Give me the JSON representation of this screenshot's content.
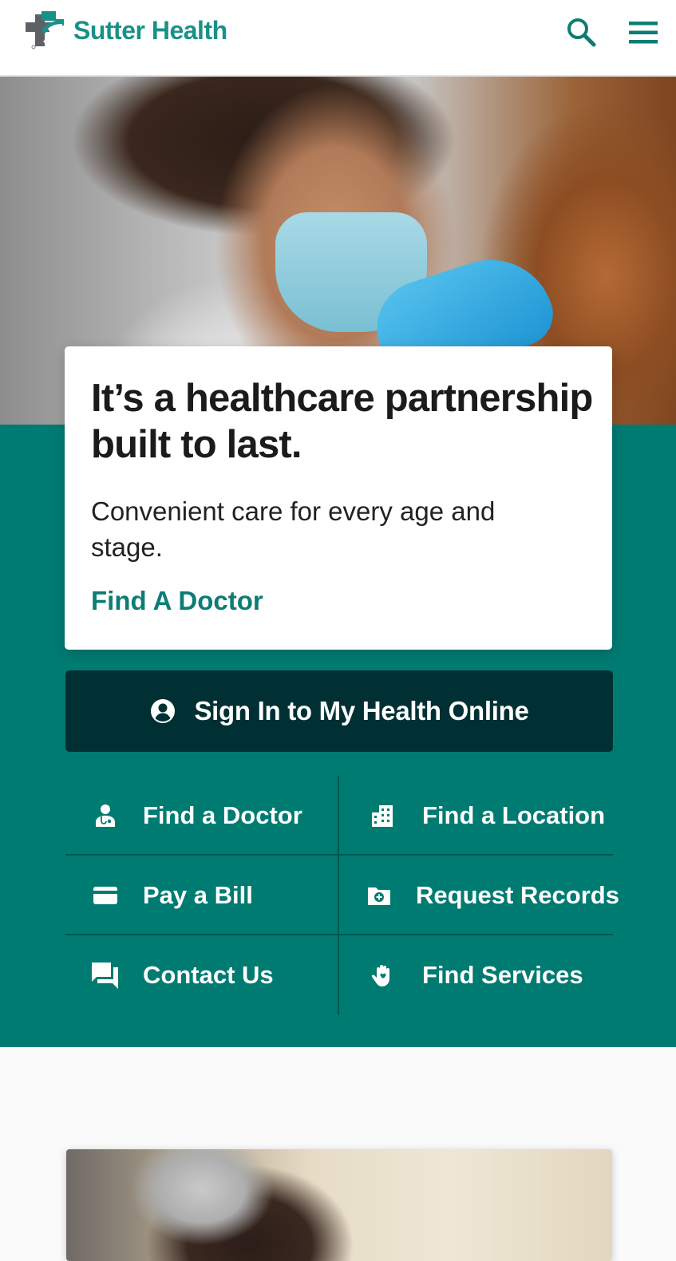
{
  "header": {
    "brand": "Sutter Health",
    "logo_icon": "sutter-health-logo-icon",
    "search_icon": "search-icon",
    "menu_icon": "hamburger-menu-icon",
    "brand_color": "#1a9188"
  },
  "hero": {
    "title": "It’s a healthcare partnership built to last.",
    "subtitle": "Convenient care for every age and stage.",
    "cta_link": "Find A Doctor"
  },
  "signin": {
    "label": "Sign In to My Health Online",
    "icon": "account-circle-icon",
    "bg_color": "#003033"
  },
  "quick_links": [
    {
      "label": "Find a Doctor",
      "icon": "doctor-icon"
    },
    {
      "label": "Find a Location",
      "icon": "building-icon"
    },
    {
      "label": "Pay a Bill",
      "icon": "credit-card-icon"
    },
    {
      "label": "Request Records",
      "icon": "medical-folder-icon"
    },
    {
      "label": "Contact Us",
      "icon": "chat-bubbles-icon"
    },
    {
      "label": "Find Services",
      "icon": "hand-heart-icon"
    }
  ],
  "colors": {
    "teal": "#007b72",
    "link": "#0d7d74"
  }
}
